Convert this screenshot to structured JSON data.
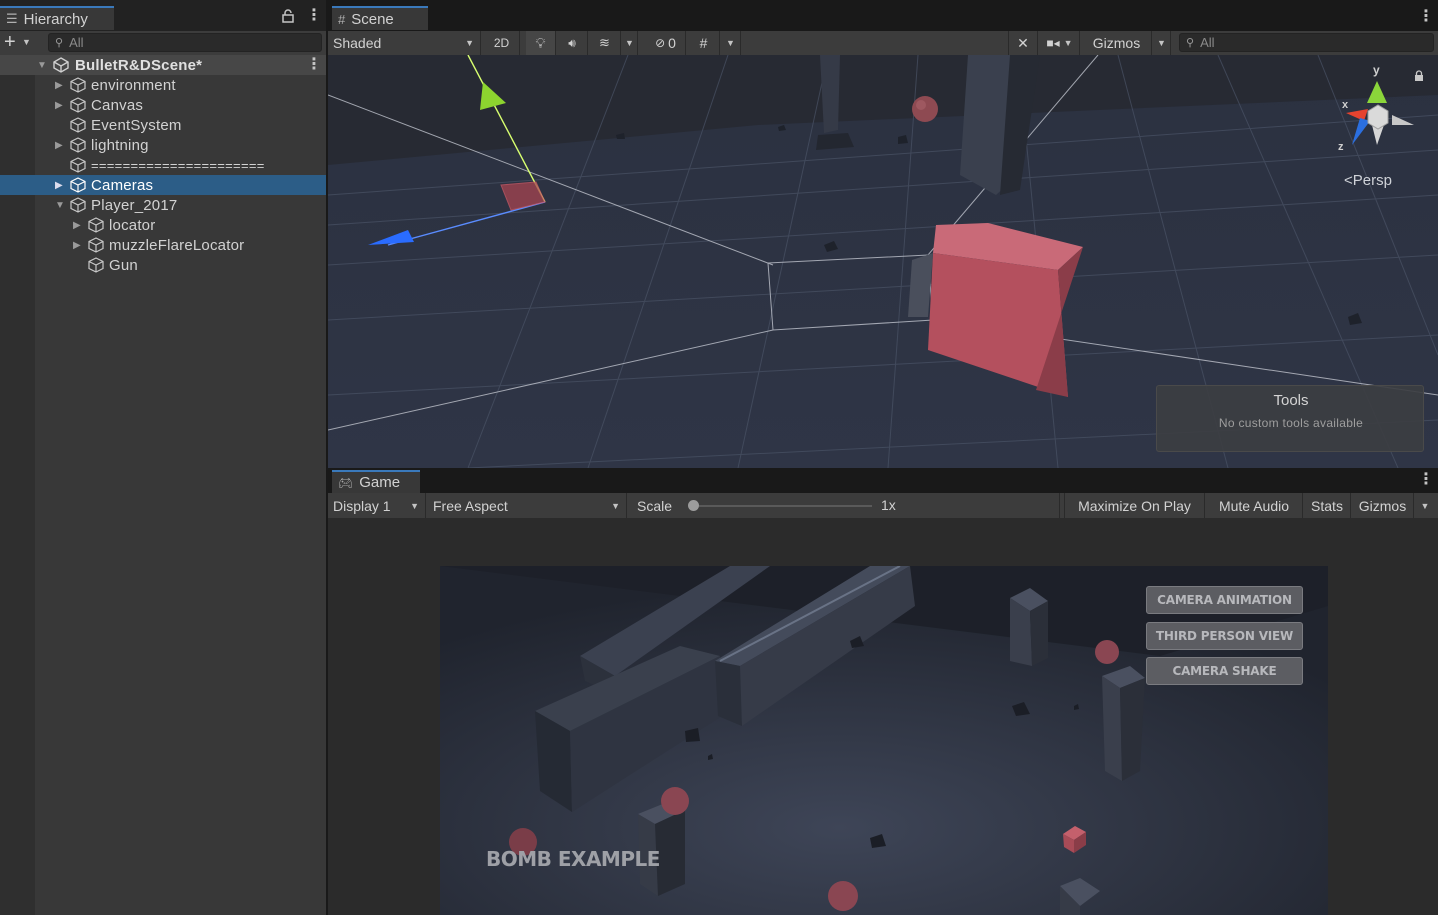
{
  "hierarchy": {
    "tab_label": "Hierarchy",
    "add_label": "+",
    "search_placeholder": "All",
    "scene_name": "BulletR&DScene*",
    "items": [
      {
        "label": "environment"
      },
      {
        "label": "Canvas"
      },
      {
        "label": "EventSystem"
      },
      {
        "label": "lightning"
      },
      {
        "label": "======================"
      },
      {
        "label": "Cameras"
      },
      {
        "label": "Player_2017"
      },
      {
        "label": "locator"
      },
      {
        "label": "muzzleFlareLocator"
      },
      {
        "label": "Gun"
      }
    ]
  },
  "scene": {
    "tab_label": "Scene",
    "shading_mode": "Shaded",
    "mode_2d": "2D",
    "hidden_count": "0",
    "gizmos_label": "Gizmos",
    "search_placeholder": "All",
    "persp_label": "Persp",
    "axis_x": "x",
    "axis_y": "y",
    "axis_z": "z",
    "tools_title": "Tools",
    "tools_subtitle": "No custom tools available"
  },
  "game": {
    "tab_label": "Game",
    "display": "Display 1",
    "aspect": "Free Aspect",
    "scale_label": "Scale",
    "scale_value": 0.0,
    "scale_text": "1x",
    "maximize_label": "Maximize On Play",
    "mute_label": "Mute Audio",
    "stats_label": "Stats",
    "gizmos_label": "Gizmos",
    "buttons": [
      {
        "label": "CAMERA ANIMATION"
      },
      {
        "label": "THIRD PERSON VIEW"
      },
      {
        "label": "CAMERA SHAKE"
      }
    ],
    "overlay_text": "BOMB EXAMPLE"
  },
  "colors": {
    "selection": "#2c5d87",
    "accent_tab": "#3a79bb",
    "panel": "#383838",
    "toolbar": "#3c3c3c",
    "cube": "#b4505e"
  }
}
